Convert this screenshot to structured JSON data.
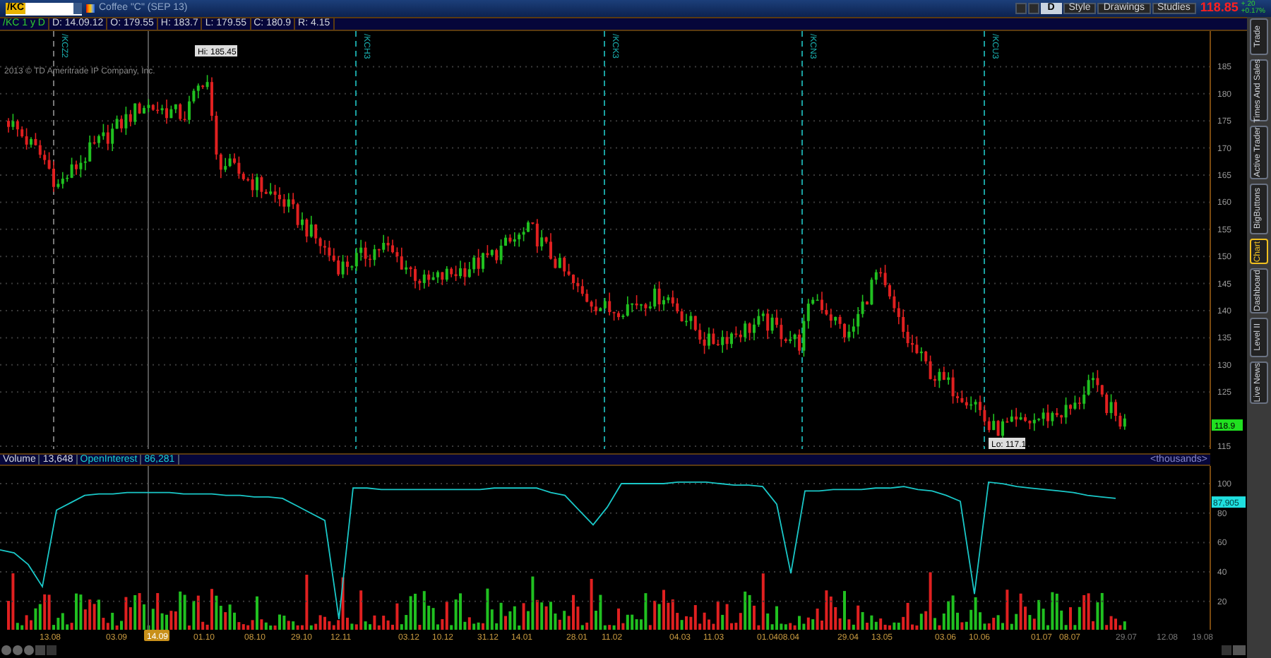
{
  "symbol": {
    "value": "/KC"
  },
  "instrument": "Coffee \"C\" (SEP 13)",
  "toolbar": {
    "buttons": [
      "D",
      "Style",
      "Drawings",
      "Studies"
    ],
    "last_price": "118.85",
    "change": "+.20",
    "change_pct": "+0.17%"
  },
  "info_bar": [
    "/KC 1 y D",
    "D: 14.09.12",
    "O: 179.55",
    "H: 183.7",
    "L: 179.55",
    "C: 180.9",
    "R: 4.15"
  ],
  "copyright": "2013 © TD Ameritrade IP Company, Inc.",
  "contract_markers": [
    "/KCZ2",
    "/KCH3",
    "/KCK3",
    "/KCN3",
    "/KCU3"
  ],
  "hi_label": "Hi: 185.45",
  "lo_label": "Lo: 117.1",
  "price_axis": [
    "185",
    "180",
    "175",
    "170",
    "165",
    "160",
    "155",
    "150",
    "145",
    "140",
    "135",
    "130",
    "125",
    "115"
  ],
  "price_tag": "118.9",
  "lower_header": {
    "volume_label": "Volume",
    "volume_value": "13,648",
    "oi_value": "86,281",
    "units": "<thousands>"
  },
  "oi_chart": {
    "chart_data": {
      "type": "line",
      "grid": true,
      "ylim": [
        0,
        112
      ],
      "yticks": [
        20,
        40,
        60,
        80,
        100
      ],
      "series": [
        {
          "name": "OpenInterest",
          "color": "#1ac8c8",
          "values": [
            55,
            53,
            45,
            30,
            82,
            87,
            92,
            93,
            93,
            94,
            94,
            94,
            94,
            93,
            93,
            93,
            92,
            92,
            91,
            91,
            90,
            85,
            80,
            75,
            8,
            97,
            97,
            96,
            96,
            96,
            96,
            96,
            96,
            96,
            96,
            97,
            97,
            97,
            97,
            94,
            92,
            82,
            72,
            84,
            100,
            100,
            100,
            100,
            101,
            101,
            101,
            100,
            99,
            99,
            98,
            86,
            39,
            95,
            95,
            96,
            96,
            96,
            97,
            97,
            98,
            96,
            95,
            92,
            88,
            25,
            101,
            100,
            98,
            97,
            96,
            95,
            94,
            92,
            91,
            90
          ]
        }
      ]
    }
  },
  "oi_tag": "87,905",
  "x_axis": [
    {
      "label": "13.08",
      "projected": false
    },
    {
      "label": "03.09",
      "projected": false
    },
    {
      "label": "01.10",
      "projected": false
    },
    {
      "label": "08.10",
      "projected": false
    },
    {
      "label": "29.10",
      "projected": false
    },
    {
      "label": "12.11",
      "projected": false
    },
    {
      "label": "03.12",
      "projected": false
    },
    {
      "label": "10.12",
      "projected": false
    },
    {
      "label": "31.12",
      "projected": false
    },
    {
      "label": "14.01",
      "projected": false
    },
    {
      "label": "28.01",
      "projected": false
    },
    {
      "label": "11.02",
      "projected": false
    },
    {
      "label": "04.03",
      "projected": false
    },
    {
      "label": "11.03",
      "projected": false
    },
    {
      "label": "01.04",
      "projected": false
    },
    {
      "label": "08.04",
      "projected": false
    },
    {
      "label": "29.04",
      "projected": false
    },
    {
      "label": "13.05",
      "projected": false
    },
    {
      "label": "03.06",
      "projected": false
    },
    {
      "label": "10.06",
      "projected": false
    },
    {
      "label": "01.07",
      "projected": false
    },
    {
      "label": "08.07",
      "projected": false
    },
    {
      "label": "29.07",
      "projected": true
    },
    {
      "label": "12.08",
      "projected": true
    },
    {
      "label": "19.08",
      "projected": true
    }
  ],
  "cursor_date": "14.09",
  "side_tabs": [
    {
      "label": "Trade",
      "selected": false
    },
    {
      "label": "Times And Sales",
      "selected": false
    },
    {
      "label": "Active Trader",
      "selected": false
    },
    {
      "label": "BigButtons",
      "selected": false
    },
    {
      "label": "Chart",
      "selected": true
    },
    {
      "label": "Dashboard",
      "selected": false
    },
    {
      "label": "Level II",
      "selected": false
    },
    {
      "label": "Live News",
      "selected": false
    }
  ]
}
